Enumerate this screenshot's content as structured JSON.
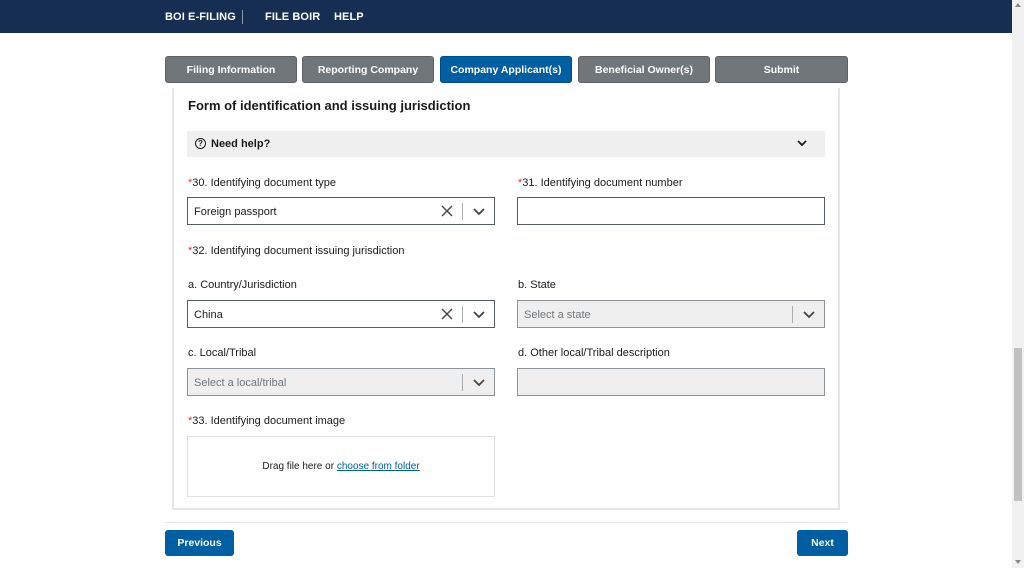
{
  "topnav": {
    "brand": "BOI E-FILING",
    "file_boir": "FILE BOIR",
    "help": "HELP"
  },
  "steps": [
    {
      "label": "Filing Information",
      "active": false
    },
    {
      "label": "Reporting Company",
      "active": false
    },
    {
      "label": "Company Applicant(s)",
      "active": true
    },
    {
      "label": "Beneficial Owner(s)",
      "active": false
    },
    {
      "label": "Submit",
      "active": false
    }
  ],
  "section": {
    "title": "Form of identification and issuing jurisdiction",
    "help_label": "Need help?",
    "help_icon": "question-circle-icon"
  },
  "fields": {
    "doc_type": {
      "required": "*",
      "label": "30. Identifying document type",
      "value": "Foreign passport"
    },
    "doc_number": {
      "required": "*",
      "label": "31. Identifying document number",
      "value": ""
    },
    "jurisdiction": {
      "required": "*",
      "label": "32. Identifying document issuing jurisdiction"
    },
    "country": {
      "label": "a. Country/Jurisdiction",
      "value": "China"
    },
    "state": {
      "label": "b. State",
      "placeholder": "Select a state"
    },
    "local": {
      "label": "c. Local/Tribal",
      "placeholder": "Select a local/tribal"
    },
    "other_local": {
      "label": "d. Other local/Tribal description",
      "value": ""
    },
    "doc_image": {
      "required": "*",
      "label": "33. Identifying document image",
      "drop_text": "Drag file here or ",
      "drop_link": "choose from folder"
    }
  },
  "footer": {
    "previous": "Previous",
    "next": "Next"
  },
  "colors": {
    "navy": "#162e51",
    "primary": "#005ea2",
    "step_inactive": "#71767a",
    "required": "#d83933"
  }
}
